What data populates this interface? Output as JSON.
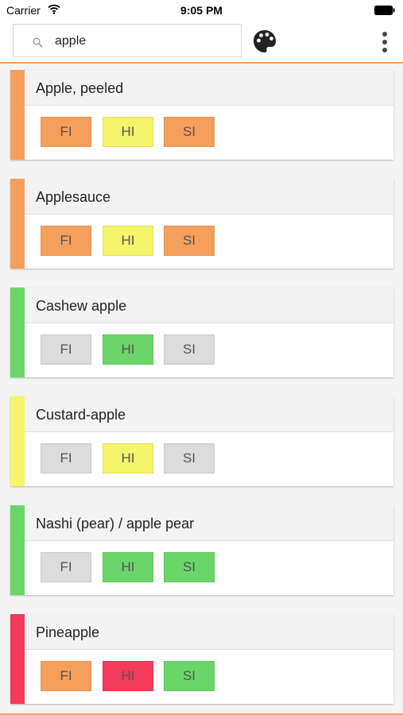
{
  "status_bar": {
    "carrier": "Carrier",
    "time": "9:05 PM"
  },
  "search": {
    "value": "apple"
  },
  "icons": {
    "search": "search-icon",
    "palette": "palette-icon",
    "menu": "more-vert-icon",
    "wifi": "wifi-icon",
    "battery": "battery-icon"
  },
  "colors": {
    "orange": "#f59f5c",
    "yellow": "#f5f56b",
    "green": "#6ad66a",
    "red": "#f33a5a",
    "gray": "#dcdcdc",
    "accent": "#f0a06a"
  },
  "labels": {
    "fi": "FI",
    "hi": "HI",
    "si": "SI"
  },
  "foods": [
    {
      "name": "Apple, peeled",
      "bar": "orange",
      "fi": "orange",
      "hi": "yellow",
      "si": "orange"
    },
    {
      "name": "Applesauce",
      "bar": "orange",
      "fi": "orange",
      "hi": "yellow",
      "si": "orange"
    },
    {
      "name": "Cashew apple",
      "bar": "green",
      "fi": "gray",
      "hi": "green",
      "si": "gray"
    },
    {
      "name": "Custard-apple",
      "bar": "yellow",
      "fi": "gray",
      "hi": "yellow",
      "si": "gray"
    },
    {
      "name": "Nashi (pear) / apple pear",
      "bar": "green",
      "fi": "gray",
      "hi": "green",
      "si": "green"
    },
    {
      "name": "Pineapple",
      "bar": "red",
      "fi": "orange",
      "hi": "red",
      "si": "green"
    }
  ]
}
